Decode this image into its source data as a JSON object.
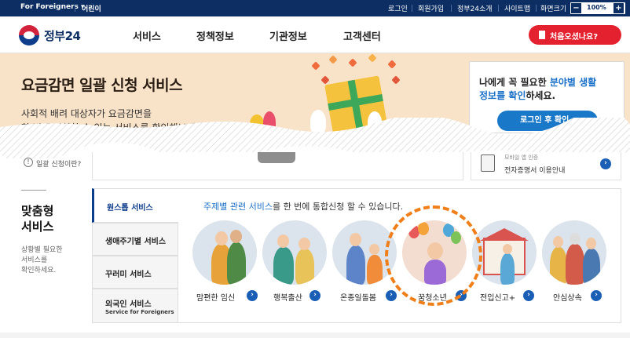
{
  "topbar": {
    "foreigners": "For Foreigners ▾",
    "kids": "어린이",
    "login": "로그인",
    "signup": "회원가입",
    "about": "정부24소개",
    "sitemap": "사이트맵",
    "zoom_label": "화면크기",
    "zoom_minus": "−",
    "zoom_value": "100%",
    "zoom_plus": "+"
  },
  "header": {
    "logo_text": "정부24",
    "nav": [
      "서비스",
      "정책정보",
      "기관정보",
      "고객센터"
    ],
    "first_visit_button": "처음오셨나요?"
  },
  "banner": {
    "title": "요금감면 일괄 신청 서비스",
    "desc_line1": "사회적 배려 대상자가 요금감면을",
    "desc_line2": "한 번에 신청할 수 있는 서비스를 확인해보세요!"
  },
  "login_box": {
    "line1_pre": "나에게 꼭 필요한 ",
    "line1_blue": "분야별 생활",
    "line2_blue": "정보를 확인",
    "line2_post": "하세요.",
    "button": "로그인 후 확인 ›"
  },
  "help": {
    "icon_glyph": "!",
    "text": "일괄 신청이란?"
  },
  "cert": {
    "line1": "모바일 앱 인증",
    "line2": "전자증명서 이용안내"
  },
  "custom_service": {
    "title_line1": "맞춤형",
    "title_line2": "서비스",
    "desc": [
      "상황별 필요한",
      "서비스를",
      "확인하세요."
    ]
  },
  "tabs": [
    {
      "label": "원스톱 서비스"
    },
    {
      "label": "생애주기별 서비스"
    },
    {
      "label": "꾸러미 서비스"
    },
    {
      "label": "외국인 서비스",
      "sub": "Service for Foreigners"
    }
  ],
  "panel": {
    "head_blue": "주제별 관련 서비스",
    "head_rest": "를 한 번에 통합신청 할 수 있습니다."
  },
  "services": [
    {
      "label": "맘편한 임신"
    },
    {
      "label": "행복출산"
    },
    {
      "label": "온종일돌봄"
    },
    {
      "label": "꿈청소년"
    },
    {
      "label": "전입신고+"
    },
    {
      "label": "안심상속"
    }
  ],
  "arrow_glyph": "›",
  "colors": {
    "topbar_bg": "#0c2e63",
    "first_visit_bg": "#e4212f",
    "banner_bg": "#f8e2c8",
    "login_button_bg": "#1a78c8",
    "highlight_ring": "#f07f1a",
    "active_tab": "#0c3c8c"
  }
}
